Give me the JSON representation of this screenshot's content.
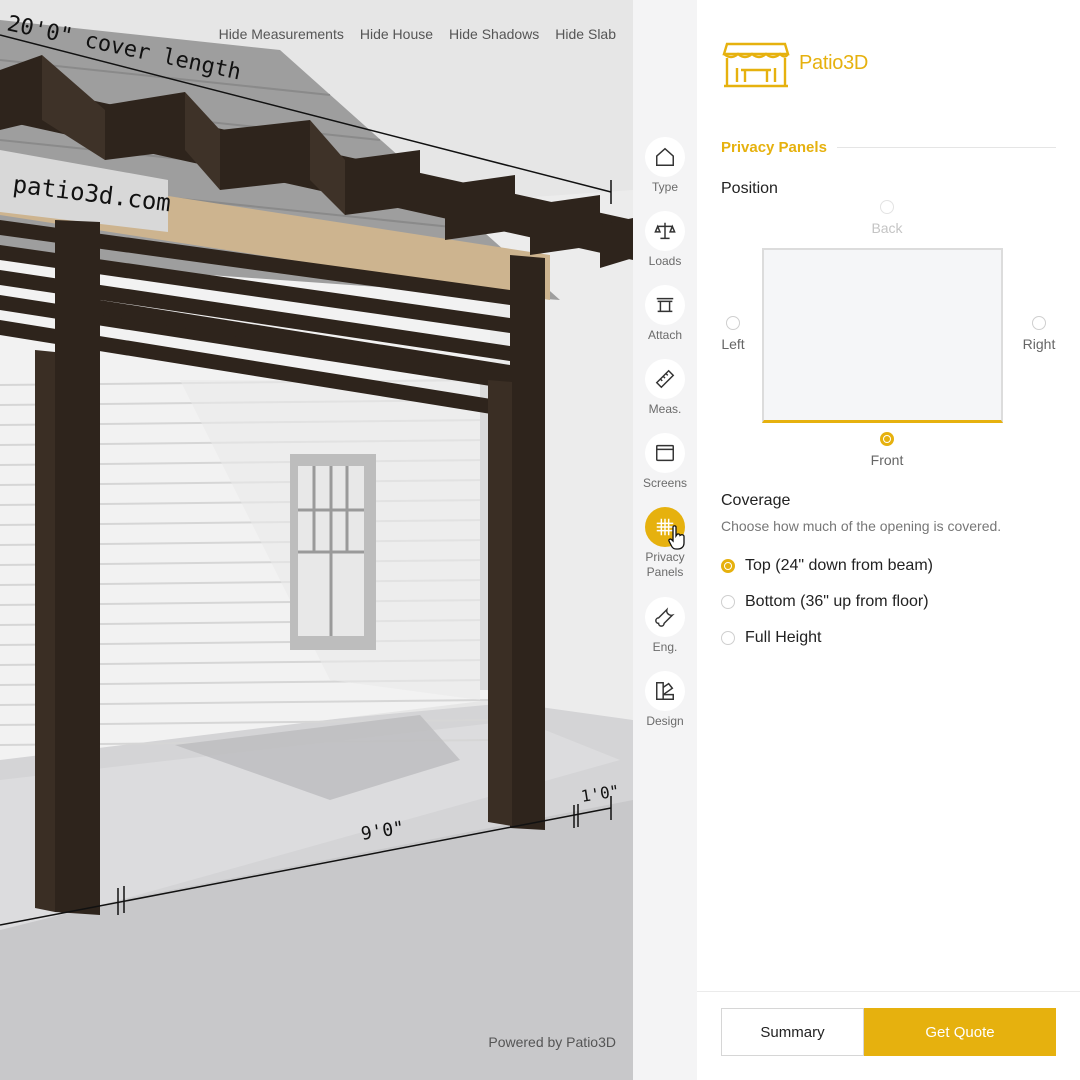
{
  "viewport": {
    "toolbar": [
      "Hide Measurements",
      "Hide House",
      "Hide Shadows",
      "Hide Slab"
    ],
    "sign_text": "patio3d.com",
    "dimensions": {
      "cover_length": "20'0\" cover length",
      "span": "9'0\"",
      "overhang": "1'0\""
    },
    "powered_by": "Powered by Patio3D"
  },
  "nav": [
    {
      "label": "Type",
      "icon": "house-icon"
    },
    {
      "label": "Loads",
      "icon": "scale-icon"
    },
    {
      "label": "Attach",
      "icon": "attach-icon"
    },
    {
      "label": "Meas.",
      "icon": "ruler-icon"
    },
    {
      "label": "Screens",
      "icon": "window-icon"
    },
    {
      "label": "Privacy Panels",
      "icon": "grid-icon",
      "active": true
    },
    {
      "label": "Eng.",
      "icon": "wrench-icon"
    },
    {
      "label": "Design",
      "icon": "palette-icon"
    }
  ],
  "panel": {
    "brand": "Patio3D",
    "section_title": "Privacy Panels",
    "position": {
      "heading": "Position",
      "back": "Back",
      "left": "Left",
      "right": "Right",
      "front": "Front",
      "selected": "Front"
    },
    "coverage": {
      "heading": "Coverage",
      "description": "Choose how much of the opening is covered.",
      "options": [
        "Top (24\" down from beam)",
        "Bottom (36\" up from floor)",
        "Full Height"
      ],
      "selected": 0
    },
    "summary_label": "Summary",
    "quote_label": "Get Quote"
  },
  "colors": {
    "accent": "#e6b10e",
    "timber": "#2e241c"
  }
}
